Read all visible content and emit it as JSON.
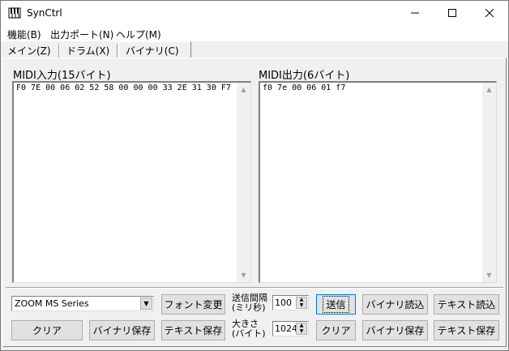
{
  "window": {
    "title": "SynCtrl"
  },
  "menu": [
    "機能(B)",
    "出力ポート(N)",
    "ヘルプ(M)"
  ],
  "tabs": [
    "メイン(Z)",
    "ドラム(X)",
    "バイナリ(C)"
  ],
  "midi_in": {
    "label": "MIDI入力(15バイト)",
    "content": "F0 7E 00 06 02 52 58 00 00 00 33 2E 31 30 F7"
  },
  "midi_out": {
    "label": "MIDI出力(6バイト)",
    "content": "f0 7e 00 06 01 f7"
  },
  "controls": {
    "device": "ZOOM MS Series",
    "font_change": "フォント変更",
    "interval_label_1": "送信間隔",
    "interval_label_2": "(ミリ秒)",
    "interval_value": "100",
    "size_label_1": "大きさ",
    "size_label_2": "(バイト)",
    "size_value": "1024",
    "send": "送信",
    "binary_load": "バイナリ読込",
    "text_load": "テキスト読込",
    "clear_left": "クリア",
    "binary_save_left": "バイナリ保存",
    "text_save_left": "テキスト保存",
    "clear_right": "クリア",
    "binary_save_right": "バイナリ保存",
    "text_save_right": "テキスト保存"
  }
}
